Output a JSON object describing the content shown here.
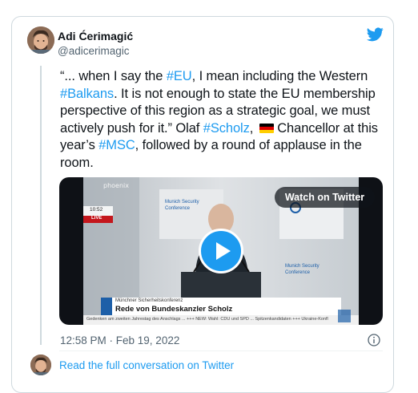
{
  "author": {
    "name": "Adi Ćerimagić",
    "handle": "@adicerimagic"
  },
  "tweet": {
    "line1_pre": "“... when I say the ",
    "hashtag_eu": "#EU",
    "line1_post": ", I mean including the Western",
    "hashtag_balkans": "#Balkans",
    "line2_post": ". It is not enough to state the EU membership perspective of this region as a strategic goal, we must actively push for it.” Olaf ",
    "hashtag_scholz": "#Scholz",
    "line3_post": ", ",
    "line4_pre": "Chancellor at this year’s ",
    "hashtag_msc": "#MSC",
    "line4_post": ", followed by a round of applause in the room."
  },
  "video": {
    "watch_label": "Watch on Twitter",
    "channel": "phoenix",
    "clock": "10:52",
    "live": "LIVE",
    "backdrop_text_1": "Munich Security",
    "backdrop_text_2": "Conference",
    "backdrop_text_3": "Munich Security",
    "backdrop_text_4": "Conference",
    "lower_third_small": "Münchner Sicherheitskonferenz",
    "lower_third_title": "Rede von Bundeskanzler Scholz",
    "ticker": "Gedenken am zweiten Jahrestag des Anschlags ... +++ NEW: Wahl: CDU und SPD ... Spitzenkandidaten +++ Ukraine-Konfl"
  },
  "timestamp": "12:58 PM · Feb 19, 2022",
  "read_link": "Read the full conversation on Twitter",
  "colors": {
    "link": "#1d9bf0",
    "text": "#0f1419",
    "muted": "#536471",
    "border": "#cfd9de"
  },
  "icons": {
    "brand": "twitter-bird-icon",
    "info": "info-icon",
    "play": "play-icon",
    "flag": "germany-flag-icon"
  }
}
